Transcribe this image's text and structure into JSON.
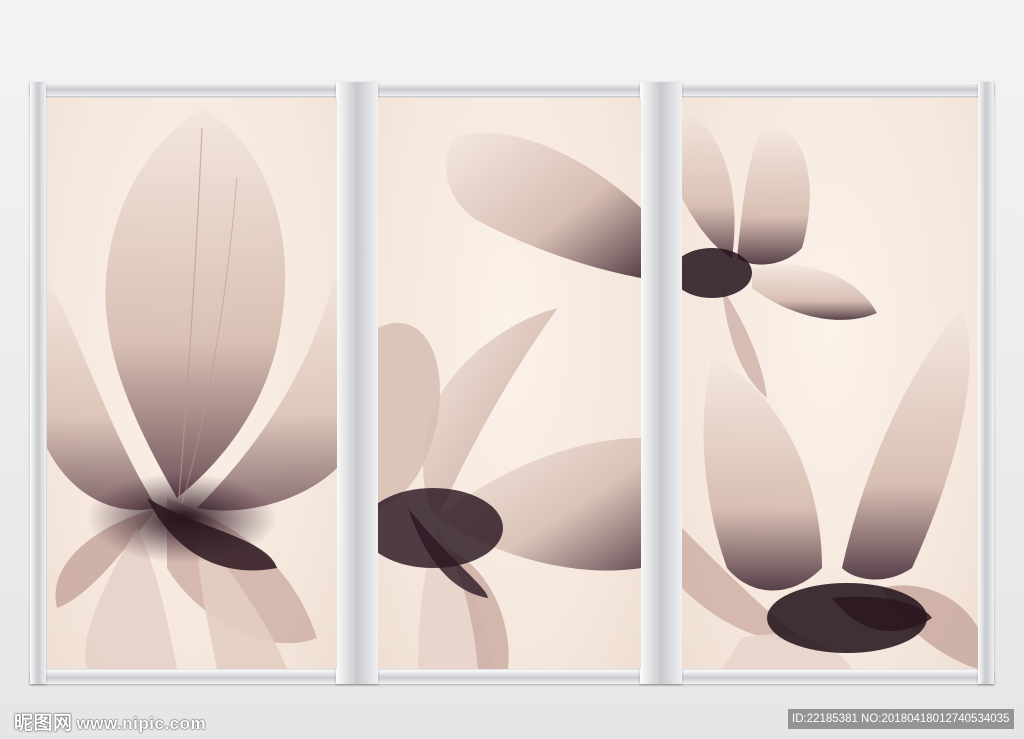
{
  "image": {
    "description_colors": {
      "background": "#efefef",
      "frame": "#c9cbcf",
      "panel": "#f6e9df",
      "petal": "#d9c2b6",
      "petal_dark": "#3a2232"
    },
    "panels": [
      {
        "name": "left-panel"
      },
      {
        "name": "middle-panel"
      },
      {
        "name": "right-panel"
      }
    ]
  },
  "watermark": {
    "site_cn": "昵图网",
    "site_url": "www.nipic.com",
    "id_text": "ID:22185381 NO:20180418012740534035"
  }
}
